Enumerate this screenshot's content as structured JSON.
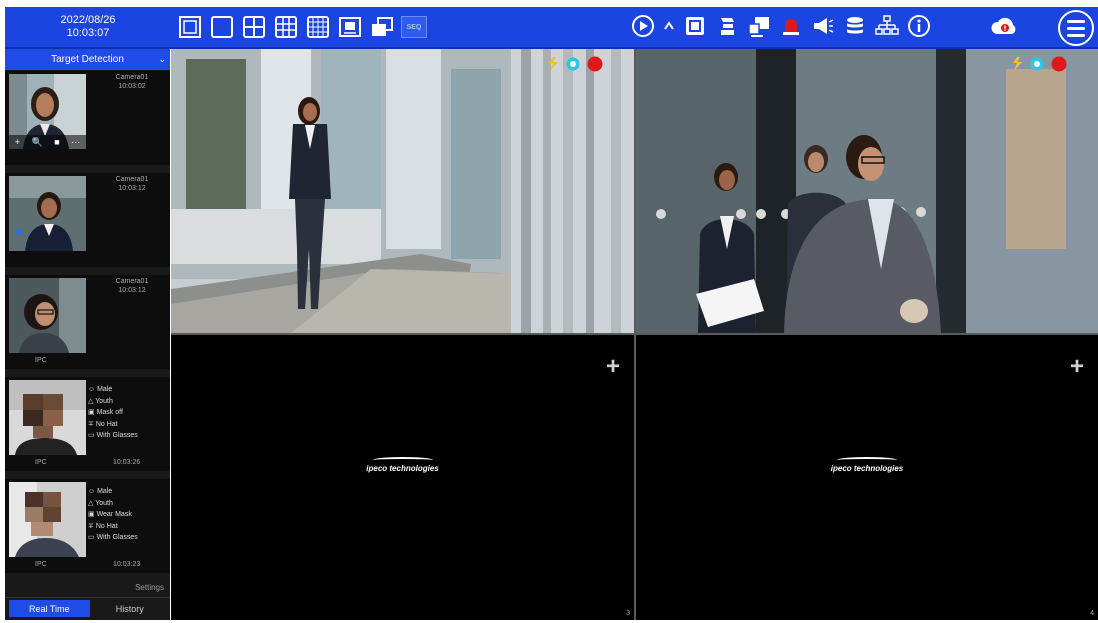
{
  "colors": {
    "toolbar_blue": "#1b45e0",
    "sidebar_bg": "#191919",
    "record_red": "#e11818",
    "face_cyan": "#29c6e6",
    "motion_yellow": "#f2c230"
  },
  "topbar": {
    "date": "2022/08/26",
    "time": "10:03:07",
    "layout_icons": [
      "fullscreen-icon",
      "single-view-icon",
      "quad-view-icon",
      "nine-view-icon",
      "sixteen-view-icon",
      "pip-icon",
      "multi-window-icon"
    ],
    "seq_label": "SEQ",
    "right_icons": [
      "playback-icon",
      "chevron-up-icon",
      "snapshot-icon",
      "ptz-icon",
      "monitor-icon",
      "alarm-icon",
      "audio-icon",
      "storage-icon",
      "network-icon",
      "info-icon"
    ]
  },
  "sidebar": {
    "title": "Target Detection",
    "cards": [
      {
        "camera": "Camera01",
        "time": "10:03:02",
        "ipc": "",
        "tools": [
          "+",
          "🔍",
          "■",
          "···"
        ]
      },
      {
        "camera": "Camera01",
        "time": "10:03:12",
        "ipc": ""
      },
      {
        "camera": "Camera01",
        "time": "10:03:12",
        "ipc": "IPC"
      },
      {
        "attrs": [
          "Male",
          "Youth",
          "Mask off",
          "No Hat",
          "With Glasses"
        ],
        "ipc": "IPC",
        "time": "10:03:26"
      },
      {
        "attrs": [
          "Male",
          "Youth",
          "Wear Mask",
          "No Hat",
          "With Glasses"
        ],
        "ipc": "IPC",
        "time": "10:03:23"
      }
    ],
    "settings_label": "Settings",
    "tabs": [
      "Real Time",
      "History"
    ]
  },
  "cells": [
    {
      "number": "",
      "brand": ""
    },
    {
      "number": "",
      "brand": ""
    },
    {
      "number": "3",
      "brand": "ipeco technologies",
      "add": "+"
    },
    {
      "number": "4",
      "brand": "ipeco technologies",
      "add": "+"
    }
  ]
}
